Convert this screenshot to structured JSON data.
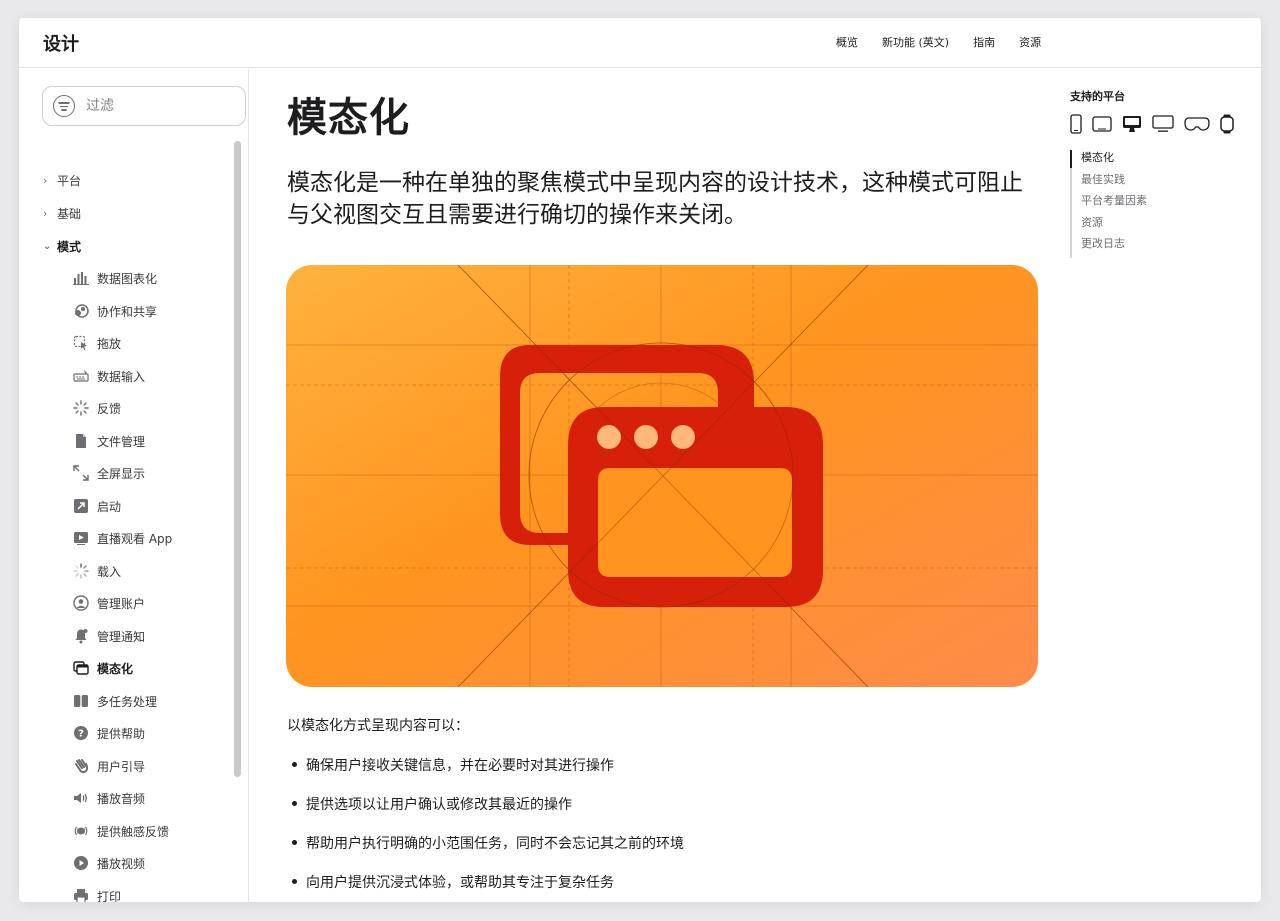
{
  "header": {
    "brand": "设计",
    "nav": [
      "概览",
      "新功能 (英文)",
      "指南",
      "资源"
    ]
  },
  "sidebar": {
    "filter_placeholder": "过滤",
    "categories": [
      {
        "label": "平台",
        "expanded": false
      },
      {
        "label": "基础",
        "expanded": false
      },
      {
        "label": "模式",
        "expanded": true
      }
    ],
    "items": [
      {
        "label": "数据图表化",
        "icon": "chart-bars-icon"
      },
      {
        "label": "协作和共享",
        "icon": "collaboration-icon"
      },
      {
        "label": "拖放",
        "icon": "drag-drop-icon"
      },
      {
        "label": "数据输入",
        "icon": "keyboard-icon"
      },
      {
        "label": "反馈",
        "icon": "feedback-sparkle-icon"
      },
      {
        "label": "文件管理",
        "icon": "document-icon"
      },
      {
        "label": "全屏显示",
        "icon": "fullscreen-arrows-icon"
      },
      {
        "label": "启动",
        "icon": "launch-arrow-icon"
      },
      {
        "label": "直播观看 App",
        "icon": "play-rectangle-icon"
      },
      {
        "label": "载入",
        "icon": "loading-spinner-icon"
      },
      {
        "label": "管理账户",
        "icon": "person-circle-icon"
      },
      {
        "label": "管理通知",
        "icon": "bell-icon"
      },
      {
        "label": "模态化",
        "icon": "modal-windows-icon",
        "active": true
      },
      {
        "label": "多任务处理",
        "icon": "split-view-icon"
      },
      {
        "label": "提供帮助",
        "icon": "question-circle-icon"
      },
      {
        "label": "用户引导",
        "icon": "waving-hand-icon"
      },
      {
        "label": "播放音频",
        "icon": "speaker-icon"
      },
      {
        "label": "提供触感反馈",
        "icon": "haptics-icon"
      },
      {
        "label": "播放视频",
        "icon": "play-circle-icon"
      },
      {
        "label": "打印",
        "icon": "printer-icon"
      }
    ]
  },
  "main": {
    "title": "模态化",
    "intro": "模态化是一种在单独的聚焦模式中呈现内容的设计技术，这种模式可阻止与父视图交互且需要进行确切的操作来关闭。",
    "lead": "以模态化方式呈现内容可以：",
    "bullets": [
      "确保用户接收关键信息，并在必要时对其进行操作",
      "提供选项以让用户确认或修改其最近的操作",
      "帮助用户执行明确的小范围任务，同时不会忘记其之前的环境",
      "向用户提供沉浸式体验，或帮助其专注于复杂任务"
    ]
  },
  "rail": {
    "platforms_title": "支持的平台",
    "platform_icons": [
      "iphone-icon",
      "ipad-icon",
      "mac-icon",
      "tv-icon",
      "vision-pro-icon",
      "watch-icon"
    ],
    "toc": [
      "模态化",
      "最佳实践",
      "平台考量因素",
      "资源",
      "更改日志"
    ]
  },
  "colors": {
    "hero_gradient_start": "#ffb23f",
    "hero_gradient_end": "#ff8b4a",
    "icon_red": "#d7200a",
    "accent_text": "#1d1d1f"
  }
}
